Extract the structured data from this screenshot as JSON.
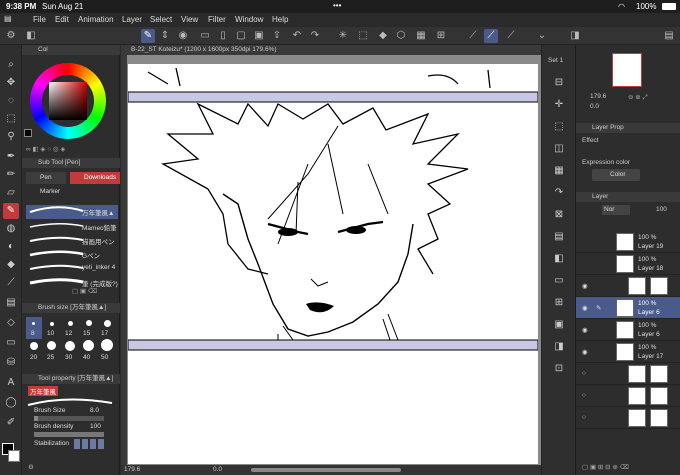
{
  "status": {
    "time": "9:38 PM",
    "date": "Sun Aug 21",
    "dots": "•••",
    "battery": "100%"
  },
  "menu": [
    "File",
    "Edit",
    "Animation",
    "Layer",
    "Select",
    "View",
    "Filter",
    "Window",
    "Help"
  ],
  "document": {
    "tab_title": "B-22_ST Koteizu* (1200 x 1600px 350dpi 179.6%)"
  },
  "color_panel": {
    "title": "Col"
  },
  "sub_tool": {
    "header": "Sub Tool [Pen]",
    "tab_pen": "Pen",
    "tab_download": "Downloads",
    "tab_marker": "Marker",
    "brushes": [
      "万年筆風▲",
      "Mameo鉛筆",
      "描画用ペン",
      "Gペン",
      "yeti_inker 4",
      "筆 (完成版?)"
    ]
  },
  "brush_size": {
    "header": "Brush size [万年筆風▲]",
    "sizes": [
      "8",
      "10",
      "12",
      "15",
      "17",
      "20",
      "25",
      "30",
      "40",
      "50"
    ]
  },
  "tool_property": {
    "header": "Tool property [万年筆風▲]",
    "brush_name": "万年筆風",
    "brush_size_label": "Brush Size",
    "brush_size_value": "8.0",
    "density_label": "Brush density",
    "density_value": "100",
    "stabilization_label": "Stabilization"
  },
  "bottom_bar": {
    "zoom": "179.6",
    "rotation": "0.0"
  },
  "navigator": {
    "zoom": "179.6",
    "angle": "0.0"
  },
  "layer_property": {
    "title": "Layer Prop",
    "effect_label": "Effect",
    "expression_label": "Expression color",
    "expression_value": "Color"
  },
  "layer_panel": {
    "title": "Layer",
    "blend": "Nor",
    "opacity": "100",
    "layers": [
      {
        "opacity": "100 %",
        "name": "Layer 19"
      },
      {
        "opacity": "100 %",
        "name": "Layer 18"
      },
      {
        "opacity": "",
        "name": ""
      },
      {
        "opacity": "100 %",
        "name": "Layer 6"
      },
      {
        "opacity": "100 %",
        "name": "Layer 6"
      },
      {
        "opacity": "100 %",
        "name": "Layer 17"
      },
      {
        "opacity": "",
        "name": ""
      },
      {
        "opacity": "",
        "name": ""
      },
      {
        "opacity": "",
        "name": ""
      }
    ]
  },
  "colors": {
    "accent": "#c43a3a",
    "selection": "#4a5a8a",
    "frame": "#c8c8e6"
  },
  "set_label": "Set 1"
}
